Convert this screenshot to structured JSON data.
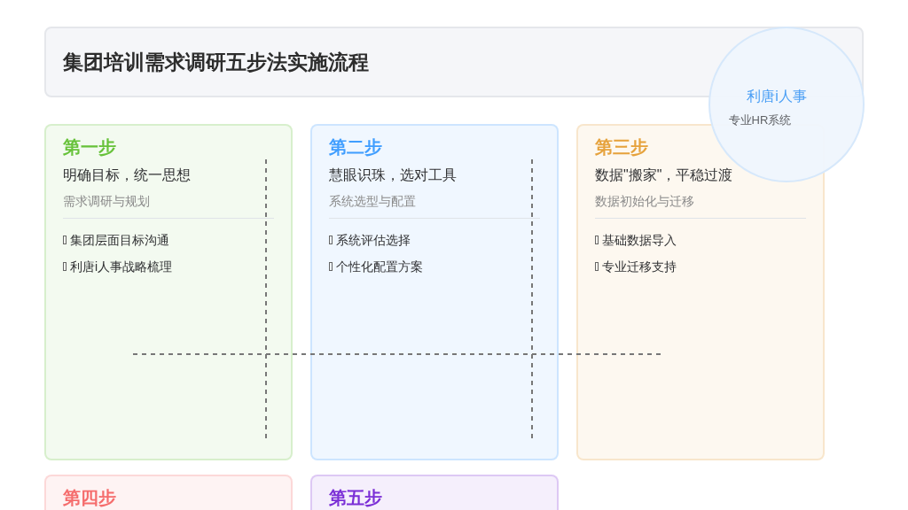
{
  "title": "集团培训需求调研五步法实施流程",
  "badge": {
    "name": "利唐i人事",
    "caption": "专业HR系统"
  },
  "steps": [
    {
      "label": "第一步",
      "heading": "明确目标，统一思想",
      "description": "需求调研与规划",
      "color": "#67c23a",
      "items": [
        "集团层面目标沟通",
        "利唐i人事战略梳理"
      ]
    },
    {
      "label": "第二步",
      "heading": "慧眼识珠，选对工具",
      "description": "系统选型与配置",
      "color": "#409eff",
      "items": [
        "系统评估选择",
        "个性化配置方案"
      ]
    },
    {
      "label": "第三步",
      "heading": "数据\"搬家\"，平稳过渡",
      "description": "数据初始化与迁移",
      "color": "#e6a23c",
      "items": [
        "基础数据导入",
        "专业迁移支持"
      ]
    },
    {
      "label": "第四步",
      "color": "#f56c6c"
    },
    {
      "label": "第五步",
      "color": "#7b2fd6"
    }
  ]
}
